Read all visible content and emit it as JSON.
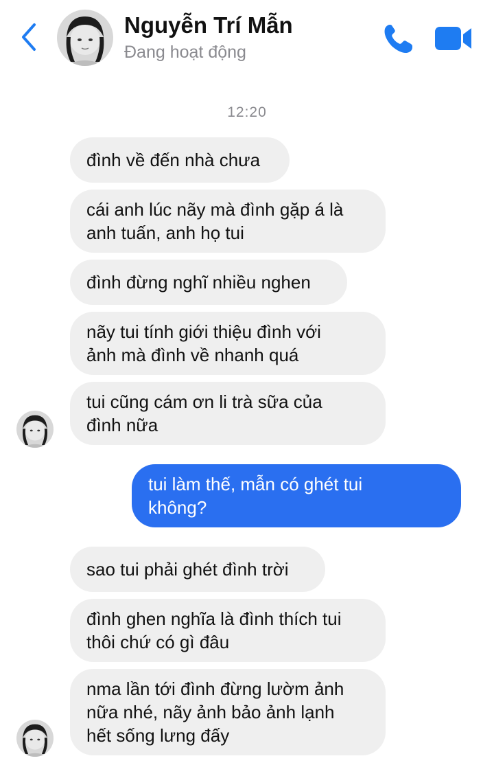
{
  "header": {
    "name": "Nguyễn Trí Mẫn",
    "status": "Đang hoạt động",
    "accent": "#1e7cf2"
  },
  "chat": {
    "timestamp": "12:20",
    "incoming_1": [
      "đình về đến nhà chưa",
      "cái anh lúc nãy mà đình gặp á là\nanh tuấn, anh họ tui",
      "đình đừng nghĩ nhiều nghen",
      "nãy tui tính giới thiệu đình với\nảnh mà đình về nhanh quá",
      "tui cũng cám ơn li trà sữa của\nđình nữa"
    ],
    "outgoing_1": "tui làm thế, mẫn có ghét tui\nkhông?",
    "incoming_2": [
      "sao tui phải ghét đình trời",
      "đình ghen nghĩa là đình thích tui\nthôi chứ có gì đâu",
      "nma lần tới đình đừng lườm ảnh\nnữa nhé, nãy ảnh bảo ảnh lạnh\nhết sống lưng đấy"
    ]
  },
  "colors": {
    "incoming_bubble": "#efefef",
    "outgoing_bubble": "#2a6ff0",
    "secondary_text": "#8a8a8f"
  },
  "icons": {
    "back": "chevron-left-icon",
    "call": "phone-icon",
    "video": "video-camera-icon"
  }
}
